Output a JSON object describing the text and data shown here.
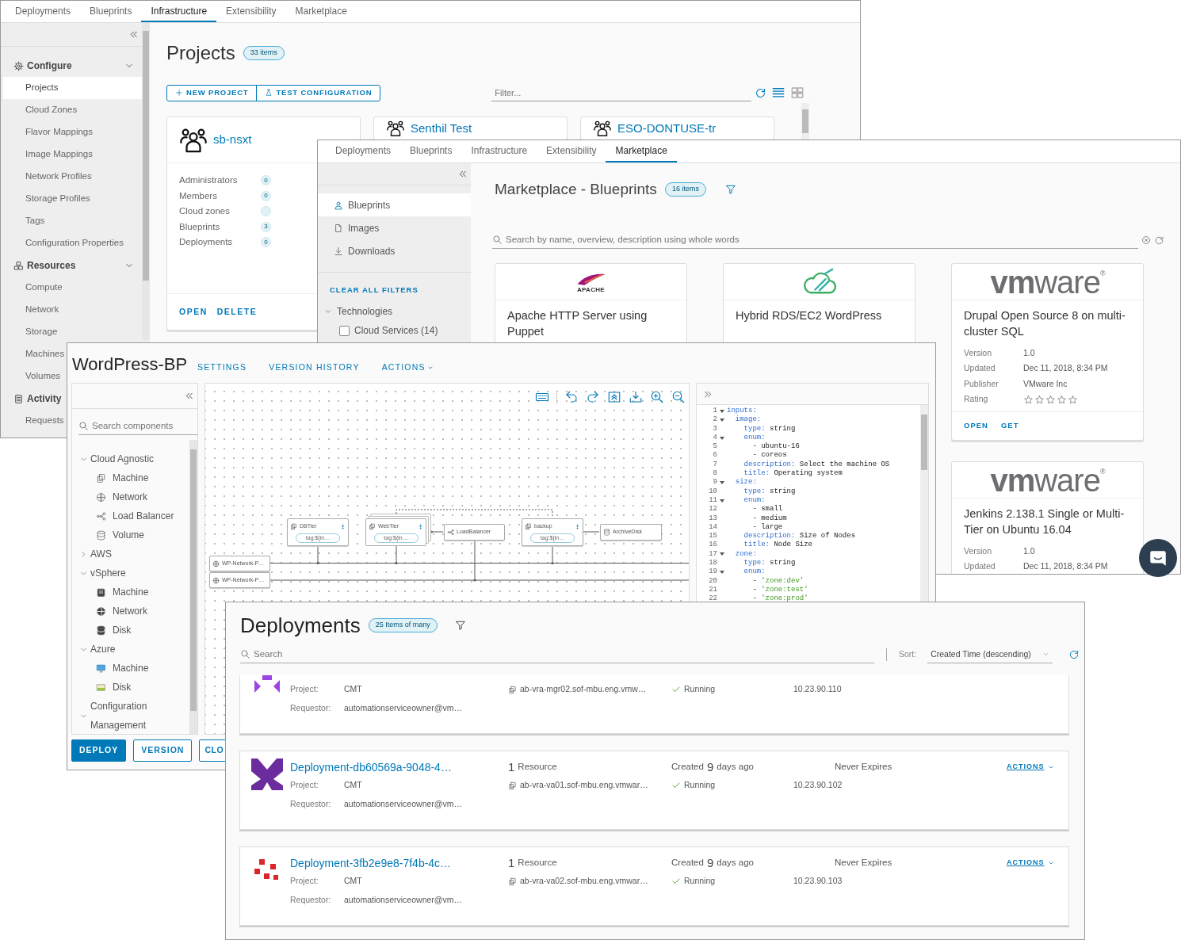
{
  "infrastructure_window": {
    "tabs": [
      {
        "label": "Deployments",
        "selected": false
      },
      {
        "label": "Blueprints",
        "selected": false
      },
      {
        "label": "Infrastructure",
        "selected": true
      },
      {
        "label": "Extensibility",
        "selected": false
      },
      {
        "label": "Marketplace",
        "selected": false
      }
    ],
    "sidebar": {
      "sections": [
        {
          "kind": "configure",
          "label": "Configure",
          "expanded": true,
          "items": [
            {
              "label": "Projects",
              "selected": true
            },
            {
              "label": "Cloud Zones",
              "selected": false
            },
            {
              "label": "Flavor Mappings",
              "selected": false
            },
            {
              "label": "Image Mappings",
              "selected": false
            },
            {
              "label": "Network Profiles",
              "selected": false
            },
            {
              "label": "Storage Profiles",
              "selected": false
            },
            {
              "label": "Tags",
              "selected": false
            },
            {
              "label": "Configuration Properties",
              "selected": false
            }
          ]
        },
        {
          "kind": "resources",
          "label": "Resources",
          "expanded": true,
          "items": [
            {
              "label": "Compute",
              "selected": false
            },
            {
              "label": "Network",
              "selected": false
            },
            {
              "label": "Storage",
              "selected": false
            },
            {
              "label": "Machines",
              "selected": false
            },
            {
              "label": "Volumes",
              "selected": false
            }
          ]
        },
        {
          "kind": "activity",
          "label": "Activity",
          "items": [
            {
              "label": "Requests",
              "selected": false
            }
          ]
        }
      ]
    },
    "title": "Projects",
    "count_badge": "33 items",
    "buttons": [
      {
        "kind": "add",
        "label": "NEW PROJECT"
      },
      {
        "kind": "test",
        "label": "TEST CONFIGURATION"
      }
    ],
    "filter": {
      "placeholder": "Filter..."
    },
    "view_buttons": [
      {
        "kind": "list",
        "selected": true
      },
      {
        "kind": "grid",
        "selected": false
      }
    ],
    "projects": [
      {
        "name": "sb-nsxt",
        "stats": [
          {
            "label": "Administrators",
            "count": "0"
          },
          {
            "label": "Members",
            "count": "0"
          },
          {
            "label": "Cloud zones"
          },
          {
            "label": "Blueprints",
            "count": "3"
          },
          {
            "label": "Deployments",
            "count": "0"
          }
        ],
        "actions": [
          "OPEN",
          "DELETE"
        ]
      },
      {
        "name": "Senthil Test"
      },
      {
        "name": "ESO-DONTUSE-tr"
      }
    ]
  },
  "marketplace_window": {
    "tabs": [
      {
        "label": "Deployments",
        "selected": false
      },
      {
        "label": "Blueprints",
        "selected": false
      },
      {
        "label": "Infrastructure",
        "selected": false
      },
      {
        "label": "Extensibility",
        "selected": false
      },
      {
        "label": "Marketplace",
        "selected": true
      }
    ],
    "sidebar": {
      "items": [
        {
          "kind": "blueprints",
          "label": "Blueprints",
          "selected": true
        },
        {
          "kind": "images",
          "label": "Images",
          "selected": false
        },
        {
          "kind": "downloads",
          "label": "Downloads",
          "selected": false
        }
      ],
      "clear_filters": "CLEAR ALL FILTERS",
      "filter_groups": [
        {
          "label": "Technologies",
          "expanded": true,
          "options": [
            {
              "label": "Cloud Services (14)",
              "checked": false
            }
          ]
        }
      ]
    },
    "title": "Marketplace - Blueprints",
    "count_badge": "16 items",
    "search": {
      "placeholder": "Search by name, overview, description using whole words"
    },
    "columns": [
      [
        {
          "logo": {
            "kind": "feather",
            "text": "APACHE"
          },
          "title": "Apache HTTP Server using Puppet"
        }
      ],
      [
        {
          "logo": {
            "kind": "cloud"
          },
          "title": "Hybrid RDS/EC2 WordPress"
        }
      ],
      [
        {
          "logo": {
            "kind": "wordmark",
            "text": "**vm**ware$^{®}$"
          },
          "title": "Drupal Open Source 8 on multi-cluster SQL",
          "details": [
            {
              "label": "Version",
              "value": "1.0"
            },
            {
              "label": "Updated",
              "value": "Dec 11, 2018, 8:34 PM"
            },
            {
              "label": "Publisher",
              "value": "VMware Inc"
            }
          ],
          "rating": {
            "label": "Rating",
            "stars": 0
          },
          "actions": [
            "OPEN",
            "GET"
          ]
        },
        {
          "logo": {
            "kind": "wordmark",
            "text": "**vm**ware$^{®}$"
          },
          "title": "Jenkins 2.138.1 Single or Multi-Tier on Ubuntu 16.04",
          "details": [
            {
              "label": "Version",
              "value": "1.0"
            },
            {
              "label": "Updated",
              "value": "Dec 11, 2018, 8:34 PM"
            }
          ]
        }
      ]
    ]
  },
  "blueprint_window": {
    "title": "WordPress-BP",
    "nav": [
      {
        "label": "SETTINGS",
        "dropdown": false
      },
      {
        "label": "VERSION HISTORY",
        "dropdown": false
      },
      {
        "label": "ACTIONS",
        "dropdown": true
      }
    ],
    "search": {
      "placeholder": "Search components"
    },
    "tree": [
      {
        "label": "Cloud Agnostic",
        "expanded": true,
        "children": [
          {
            "label": "Machine",
            "kind": "machine"
          },
          {
            "label": "Network",
            "kind": "network"
          },
          {
            "label": "Load Balancer",
            "kind": "load-balancer"
          },
          {
            "label": "Volume",
            "kind": "volume"
          }
        ]
      },
      {
        "label": "AWS",
        "expanded": false
      },
      {
        "label": "vSphere",
        "expanded": true,
        "children": [
          {
            "label": "Machine",
            "kind": "vsphere-machine"
          },
          {
            "label": "Network",
            "kind": "vsphere-network"
          },
          {
            "label": "Disk",
            "kind": "vsphere-disk"
          }
        ]
      },
      {
        "label": "Azure",
        "expanded": true,
        "children": [
          {
            "label": "Machine",
            "kind": "azure-machine"
          },
          {
            "label": "Disk",
            "kind": "azure-disk"
          }
        ]
      },
      {
        "label": "Configuration Management",
        "expanded": true
      }
    ],
    "buttons": [
      {
        "kind": "primary",
        "label": "DEPLOY"
      },
      {
        "kind": "outline",
        "label": "VERSION"
      },
      {
        "kind": "outline",
        "label": "CLO"
      }
    ],
    "nodes": [
      {
        "kind": "machine",
        "label": "DBTier",
        "tag": "tag:${in…",
        "stacked": false
      },
      {
        "kind": "machine",
        "label": "WebTier",
        "tag": "tag:${in…",
        "stacked": true
      },
      {
        "kind": "load-balancer",
        "label": "LoadBalancer",
        "stacked": false
      },
      {
        "kind": "machine",
        "label": "backup",
        "tag": "tag:${in…",
        "stacked": false
      },
      {
        "kind": "volume",
        "label": "ArchiveDisk",
        "stacked": false
      },
      {
        "kind": "network",
        "label": "WP-Network-P…",
        "stacked": false
      },
      {
        "kind": "network",
        "label": "WP-Network-P…",
        "stacked": false
      }
    ],
    "code": [
      {
        "num": "1",
        "foldable": true,
        "parts": [
          {
            "kind": "key",
            "text": "inputs:"
          }
        ]
      },
      {
        "num": "2",
        "foldable": true,
        "parts": [
          {
            "kind": "key",
            "text": "  image:"
          }
        ]
      },
      {
        "num": "3",
        "foldable": false,
        "parts": [
          {
            "kind": "key",
            "text": "    type:"
          },
          {
            "kind": "plain",
            "text": " string"
          }
        ]
      },
      {
        "num": "4",
        "foldable": true,
        "parts": [
          {
            "kind": "key",
            "text": "    enum:"
          }
        ]
      },
      {
        "num": "5",
        "foldable": false,
        "parts": [
          {
            "kind": "plain",
            "text": "      - ubuntu-16"
          }
        ]
      },
      {
        "num": "6",
        "foldable": false,
        "parts": [
          {
            "kind": "plain",
            "text": "      - coreos"
          }
        ]
      },
      {
        "num": "7",
        "foldable": false,
        "parts": [
          {
            "kind": "key",
            "text": "    description:"
          },
          {
            "kind": "plain",
            "text": " Select the machine OS"
          }
        ]
      },
      {
        "num": "8",
        "foldable": false,
        "parts": [
          {
            "kind": "key",
            "text": "    title:"
          },
          {
            "kind": "plain",
            "text": " Operating system"
          }
        ]
      },
      {
        "num": "9",
        "foldable": true,
        "parts": [
          {
            "kind": "key",
            "text": "  size:"
          }
        ]
      },
      {
        "num": "10",
        "foldable": false,
        "parts": [
          {
            "kind": "key",
            "text": "    type:"
          },
          {
            "kind": "plain",
            "text": " string"
          }
        ]
      },
      {
        "num": "11",
        "foldable": true,
        "parts": [
          {
            "kind": "key",
            "text": "    enum:"
          }
        ]
      },
      {
        "num": "12",
        "foldable": false,
        "parts": [
          {
            "kind": "plain",
            "text": "      - small"
          }
        ]
      },
      {
        "num": "13",
        "foldable": false,
        "parts": [
          {
            "kind": "plain",
            "text": "      - medium"
          }
        ]
      },
      {
        "num": "14",
        "foldable": false,
        "parts": [
          {
            "kind": "plain",
            "text": "      - large"
          }
        ]
      },
      {
        "num": "15",
        "foldable": false,
        "parts": [
          {
            "kind": "key",
            "text": "    description:"
          },
          {
            "kind": "plain",
            "text": " Size of Nodes"
          }
        ]
      },
      {
        "num": "16",
        "foldable": false,
        "parts": [
          {
            "kind": "key",
            "text": "    title:"
          },
          {
            "kind": "plain",
            "text": " Node Size"
          }
        ]
      },
      {
        "num": "17",
        "foldable": true,
        "parts": [
          {
            "kind": "key",
            "text": "  zone:"
          }
        ]
      },
      {
        "num": "18",
        "foldable": false,
        "parts": [
          {
            "kind": "key",
            "text": "    type:"
          },
          {
            "kind": "plain",
            "text": " string"
          }
        ]
      },
      {
        "num": "19",
        "foldable": true,
        "parts": [
          {
            "kind": "key",
            "text": "    enum:"
          }
        ]
      },
      {
        "num": "20",
        "foldable": false,
        "parts": [
          {
            "kind": "plain",
            "text": "      - "
          },
          {
            "kind": "string",
            "text": "'zone:dev'"
          }
        ]
      },
      {
        "num": "21",
        "foldable": false,
        "parts": [
          {
            "kind": "plain",
            "text": "      - "
          },
          {
            "kind": "string",
            "text": "'zone:test'"
          }
        ]
      },
      {
        "num": "22",
        "foldable": false,
        "parts": [
          {
            "kind": "plain",
            "text": "      - "
          },
          {
            "kind": "string",
            "text": "'zone:prod'"
          }
        ]
      }
    ]
  },
  "deployments_window": {
    "title": "Deployments",
    "count_badge": "25 Items of many",
    "search": {
      "placeholder": "Search"
    },
    "sort": {
      "label": "Sort:",
      "value": "Created Time (descending)"
    },
    "rows": [
      {
        "color": "#9b45e4",
        "project_label": "Project:",
        "project": "CMT",
        "requestor_label": "Requestor:",
        "requestor": "automationserviceowner@vm…",
        "host": "ab-vra-mgr02.sof-mbu.eng.vmw…",
        "status": "Running",
        "ip": "10.23.90.110"
      },
      {
        "color": "#6b2c9e",
        "name": "Deployment-db60569a-9048-4…",
        "resource_count": "1",
        "resource_label": "Resource",
        "created": {
          "prefix": "Created",
          "count": "9",
          "unit": "days ago"
        },
        "expires": "Never Expires",
        "actions": "ACTIONS",
        "project_label": "Project:",
        "project": "CMT",
        "requestor_label": "Requestor:",
        "requestor": "automationserviceowner@vm…",
        "host": "ab-vra-va01.sof-mbu.eng.vmwar…",
        "status": "Running",
        "ip": "10.23.90.102"
      },
      {
        "color": "#d9262c",
        "name": "Deployment-3fb2e9e8-7f4b-4c…",
        "resource_count": "1",
        "resource_label": "Resource",
        "created": {
          "prefix": "Created",
          "count": "9",
          "unit": "days ago"
        },
        "expires": "Never Expires",
        "actions": "ACTIONS",
        "project_label": "Project:",
        "project": "CMT",
        "requestor_label": "Requestor:",
        "requestor": "automationserviceowner@vm…",
        "host": "ab-vra-va02.sof-mbu.eng.vmwar…",
        "status": "Running",
        "ip": "10.23.90.103"
      }
    ]
  }
}
